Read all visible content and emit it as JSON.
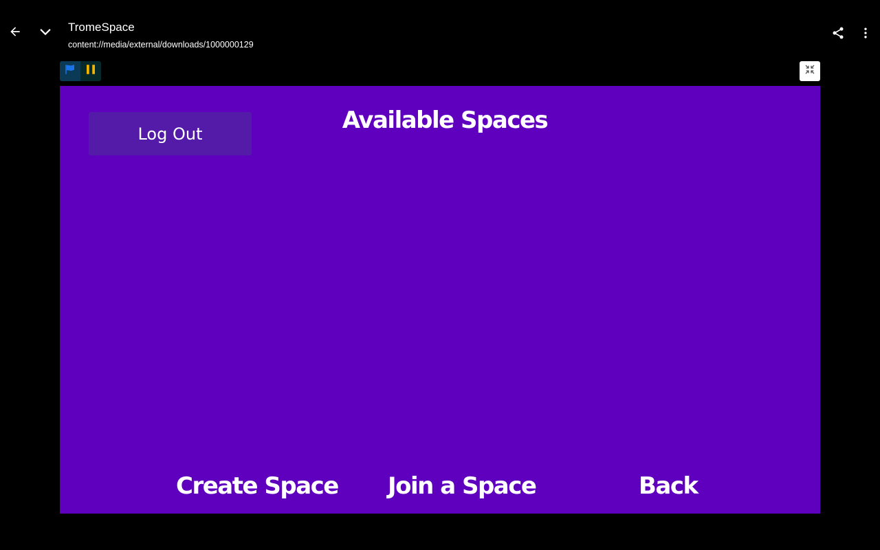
{
  "header": {
    "title": "TromeSpace",
    "subtitle": "content://media/external/downloads/1000000129",
    "icons": {
      "back": "arrow-left-icon",
      "collapse": "chevron-down-icon",
      "share": "share-icon",
      "more": "more-vert-icon"
    }
  },
  "player_controls": {
    "flag_icon": "green-flag-icon",
    "pause_icon": "pause-icon",
    "fullscreen_icon": "fullscreen-exit-icon",
    "colors": {
      "flag": "#1a73e8",
      "pause": "#f5b400"
    }
  },
  "stage": {
    "background": "#5f00bf",
    "title": "Available Spaces",
    "logout_label": "Log Out",
    "buttons": {
      "create": "Create Space",
      "join": "Join a Space",
      "back": "Back"
    }
  }
}
